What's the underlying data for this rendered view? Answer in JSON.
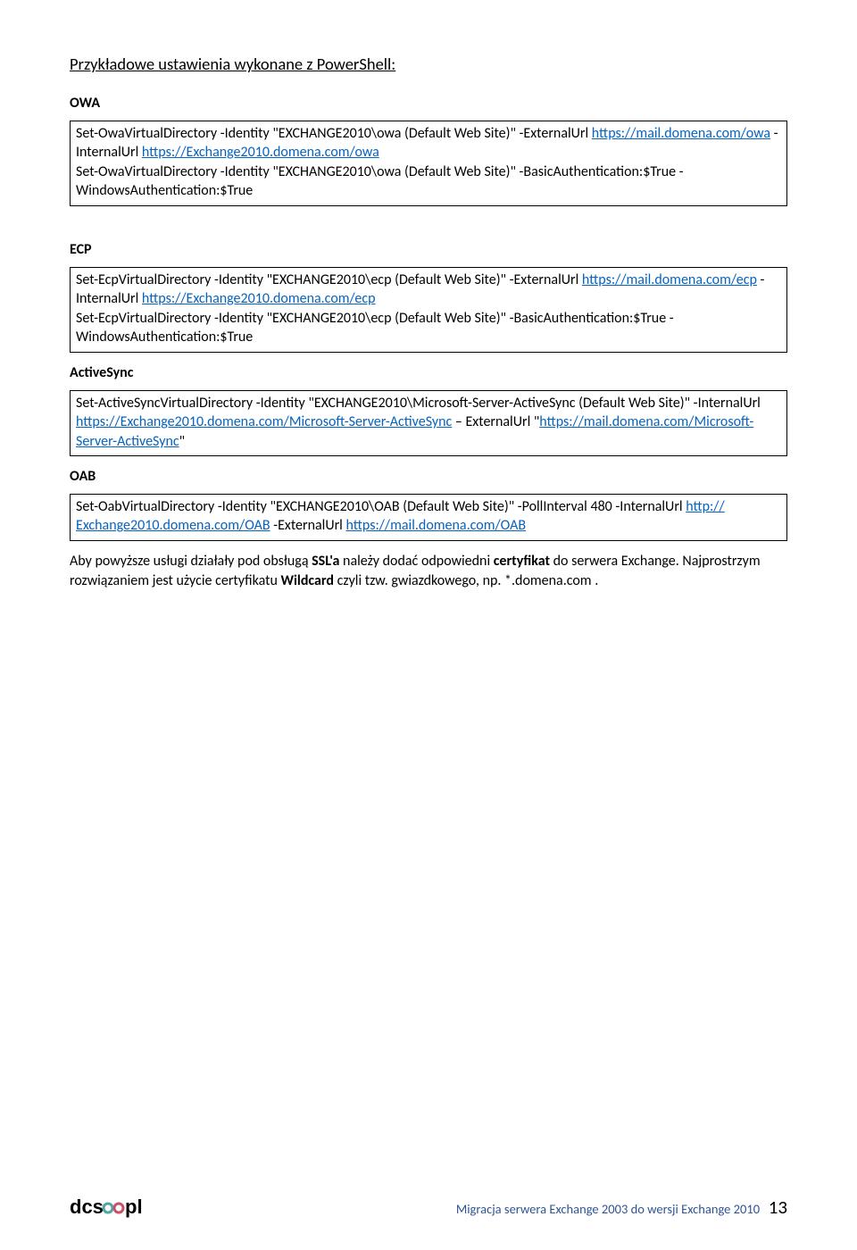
{
  "heading": "Przykładowe ustawienia wykonane z PowerShell:",
  "sections": {
    "owa": {
      "title": "OWA",
      "box": {
        "p1a": "Set-OwaVirtualDirectory -Identity \"EXCHANGE2010\\owa (Default Web Site)\" -ExternalUrl ",
        "p1link1": "https://mail.domena.com/owa",
        "p1b": " -InternalUrl ",
        "p1link2": "https://Exchange2010.domena.com/owa",
        "p2": "Set-OwaVirtualDirectory -Identity \"EXCHANGE2010\\owa (Default Web Site)\" -BasicAuthentication:$True -WindowsAuthentication:$True"
      }
    },
    "ecp": {
      "title": "ECP",
      "box": {
        "p1a": "Set-EcpVirtualDirectory -Identity \"EXCHANGE2010\\ecp (Default Web Site)\" -ExternalUrl ",
        "p1link1": "https://mail.domena.com/ecp",
        "p1b": " -InternalUrl ",
        "p1link2": "https://Exchange2010.domena.com/ecp",
        "p2": "Set-EcpVirtualDirectory -Identity \"EXCHANGE2010\\ecp (Default Web Site)\" -BasicAuthentication:$True -WindowsAuthentication:$True"
      }
    },
    "activesync": {
      "title": "ActiveSync",
      "box": {
        "p1a": "Set-ActiveSyncVirtualDirectory -Identity \"EXCHANGE2010\\Microsoft-Server-ActiveSync (Default Web Site)\" -InternalUrl ",
        "p1link1": "https://Exchange2010.domena.com/Microsoft-Server-ActiveSync",
        "p1b": " – ExternalUrl \"",
        "p1link2": "https://mail.domena.com/Microsoft-Server-ActiveSync",
        "p1c": "\""
      }
    },
    "oab": {
      "title": "OAB",
      "box": {
        "p1a": "Set-OabVirtualDirectory -Identity \"EXCHANGE2010\\OAB (Default Web Site)\" -PollInterval 480 -InternalUrl ",
        "p1link1": "http:// Exchange2010.domena.com/OAB",
        "p1b": " -ExternalUrl ",
        "p1link2": "https://mail.domena.com/OAB"
      }
    }
  },
  "closing": {
    "p1a": "Aby powyższe usługi działały pod obsługą ",
    "p1b": "SSL'a",
    "p1c": " należy dodać odpowiedni ",
    "p1d": "certyfikat",
    "p1e": " do serwera Exchange. Najprostrzym rozwiązaniem jest użycie certyfikatu ",
    "p1f": "Wildcard",
    "p1g": " czyli tzw. gwiazdkowego, np. *.domena.com ."
  },
  "footer": {
    "text": "Migracja serwera Exchange 2003  do wersji Exchange 2010",
    "page": "13",
    "logo_text": "dcs",
    "logo_suffix": "pl"
  }
}
